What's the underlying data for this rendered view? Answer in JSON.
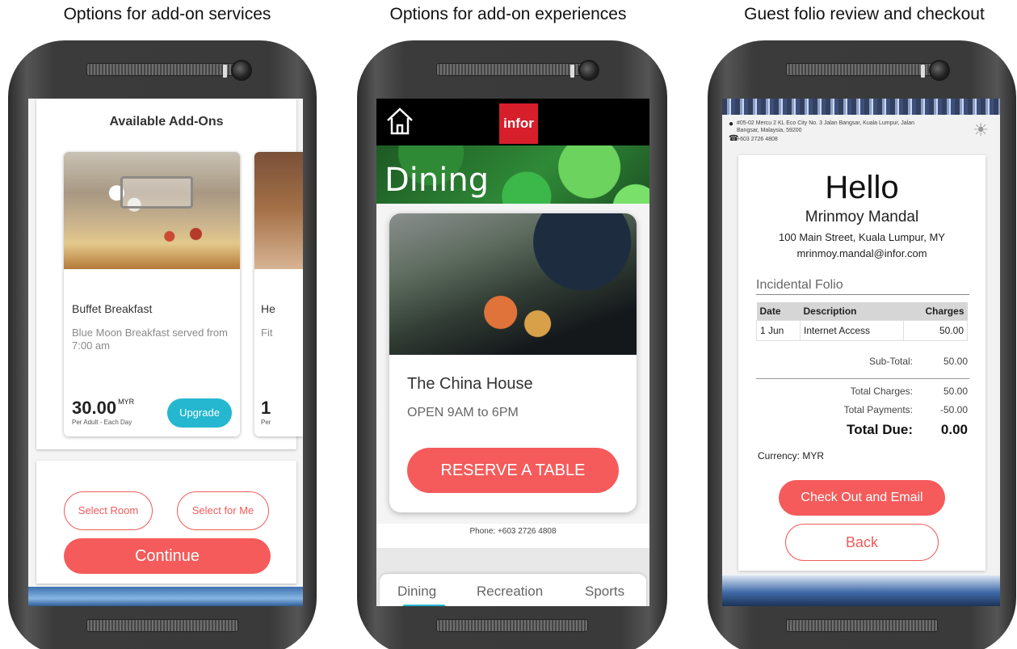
{
  "captions": {
    "phone1": "Options for add-on services",
    "phone2": "Options for add-on experiences",
    "phone3": "Guest folio review and checkout"
  },
  "addons": {
    "title": "Available Add-Ons",
    "cards": [
      {
        "title": "Buffet Breakfast",
        "description": "Blue Moon Breakfast served from 7:00 am",
        "price": "30.00",
        "currency": "MYR",
        "unit": "Per Adult - Each Day",
        "action": "Upgrade"
      },
      {
        "title": "He",
        "description": "Fit",
        "price": "1",
        "unit": "Per"
      }
    ],
    "select_room": "Select Room",
    "select_for_me": "Select for Me",
    "continue": "Continue"
  },
  "experiences": {
    "logo": "infor",
    "hero_title": "Dining",
    "restaurant": {
      "name": "The China House",
      "hours": "OPEN 9AM to 6PM",
      "action": "RESERVE A TABLE"
    },
    "phone": "Phone: +603 2726 4808",
    "tabs": [
      {
        "label": "Dining",
        "active": true
      },
      {
        "label": "Recreation",
        "active": false
      },
      {
        "label": "Sports",
        "active": false
      }
    ],
    "accent_color": "#24b7cf"
  },
  "folio": {
    "address": "#05-02 Mercu 2 KL Eco City No. 3 Jalan Bangsar, Kuala Lumpur, Jalan Bangsar, Malaysia, 59200",
    "hotel_phone": "+603 2726 4808",
    "greeting": "Hello",
    "guest_name": "Mrinmoy Mandal",
    "guest_address": "100 Main Street, Kuala Lumpur, MY",
    "guest_email": "mrinmoy.mandal@infor.com",
    "section_title": "Incidental Folio",
    "columns": [
      "Date",
      "Description",
      "Charges"
    ],
    "rows": [
      [
        "1 Jun",
        "Internet Access",
        "50.00"
      ]
    ],
    "subtotal_label": "Sub-Total:",
    "subtotal_value": "50.00",
    "total_charges_label": "Total Charges:",
    "total_charges_value": "50.00",
    "total_payments_label": "Total Payments:",
    "total_payments_value": "-50.00",
    "total_due_label": "Total Due:",
    "total_due_value": "0.00",
    "currency": "Currency: MYR",
    "checkout": "Check Out and Email",
    "back": "Back"
  },
  "colors": {
    "primary_red": "#f55b5b",
    "teal": "#24b7cf",
    "infor_red": "#d71e2b"
  }
}
